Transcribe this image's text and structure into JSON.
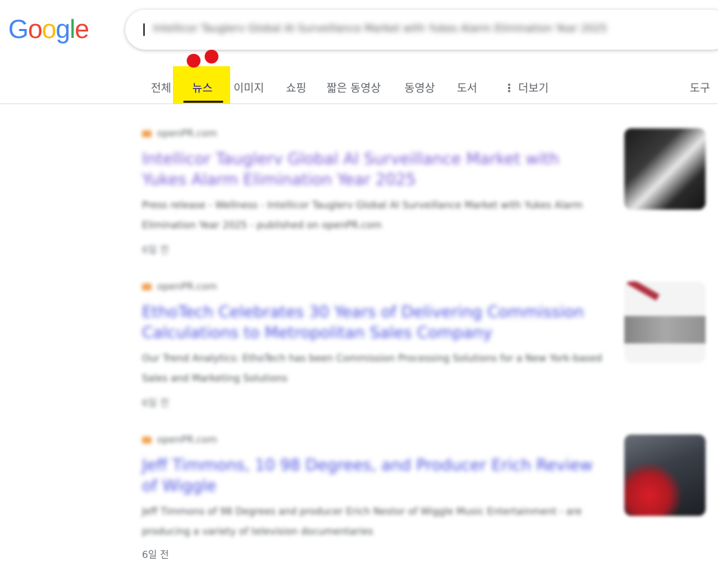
{
  "logo": {
    "letters": [
      "G",
      "o",
      "o",
      "g",
      "l",
      "e"
    ],
    "colors": [
      "#4285F4",
      "#EA4335",
      "#FBBC05",
      "#4285F4",
      "#34A853",
      "#EA4335"
    ]
  },
  "search": {
    "query": "Intellicor Tauglerv Global AI Surveillance Market with Yukes Alarm Elimination Year 2025"
  },
  "tabs": {
    "all": "전체",
    "news": "뉴스",
    "images": "이미지",
    "shopping": "쇼핑",
    "shorts": "짧은 동영상",
    "videos": "동영상",
    "books": "도서",
    "more": "더보기",
    "tools": "도구"
  },
  "results": [
    {
      "source": "openPR.com",
      "title": "Intellicor Tauglerv Global AI Surveillance Market with Yukes Alarm Elimination Year 2025",
      "snippet": "Press release - Wellness - Intellicor Tauglerv Global AI Surveillance Market with Yukes Alarm Elimination Year 2025 - published on openPR.com",
      "date": "6일 전"
    },
    {
      "source": "openPR.com",
      "title": "EthoTech Celebrates 30 Years of Delivering Commission Calculations to Metropolitan Sales Company",
      "snippet": "Our Trend Analytics: EthoTech has been Commission Processing Solutions for a New York-based Sales and Marketing Solutions",
      "date": "6일 전"
    },
    {
      "source": "openPR.com",
      "title": "Jeff Timmons, 10 98 Degrees, and Producer Erich Review of Wiggle",
      "snippet": "Jeff Timmons of 98 Degrees and producer Erich Nestor of Wiggle Music Entertainment - are producing a variety of television documentaries",
      "date": "6일 전"
    }
  ],
  "colors": {
    "accent": "#1a0dab",
    "highlight": "#ffee00",
    "marker": "#e3141b"
  }
}
